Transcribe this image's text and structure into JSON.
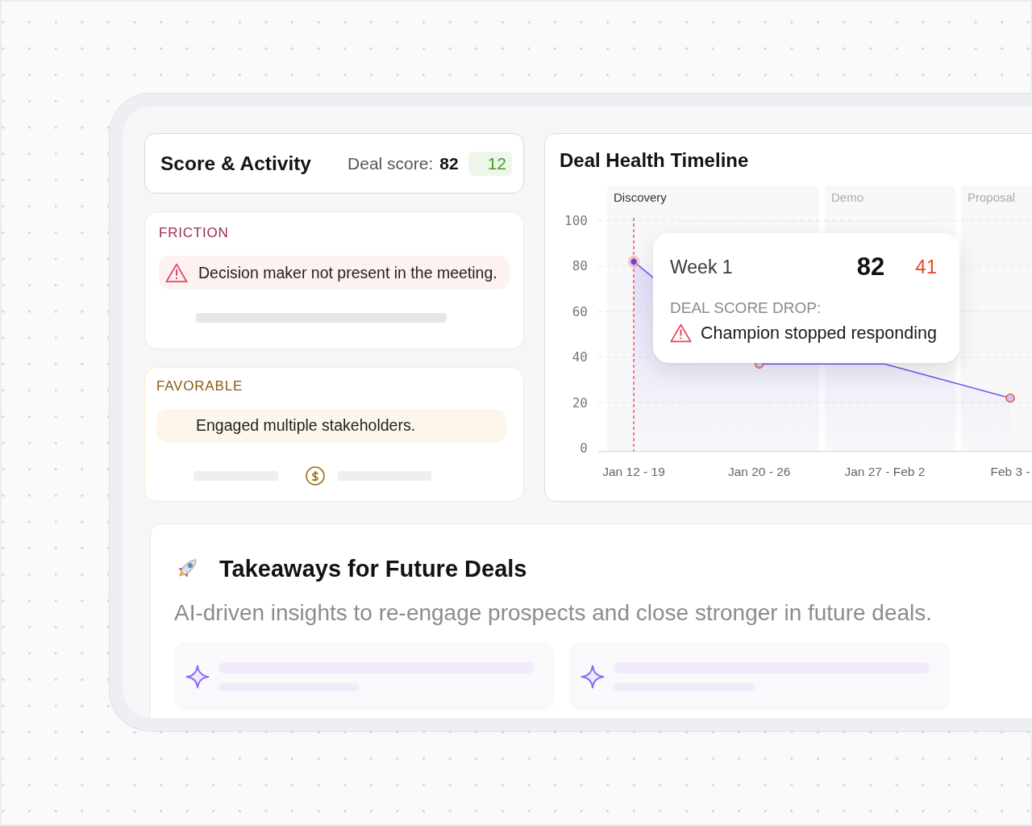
{
  "score_card": {
    "title": "Score & Activity",
    "label": "Deal score:",
    "score": "82",
    "change": "12",
    "positive": true
  },
  "sections": [
    {
      "kind": "friction",
      "title": "FRICTION",
      "items": [
        {
          "text": "Decision maker not present in the meeting."
        }
      ]
    },
    {
      "kind": "favorable",
      "title": "FAVORABLE",
      "items": [
        {
          "text": "Engaged multiple stakeholders."
        }
      ]
    }
  ],
  "timeline": {
    "title": "Deal Health Timeline",
    "phases": [
      {
        "label": "Discovery",
        "selected": true
      },
      {
        "label": "Demo",
        "selected": false
      },
      {
        "label": "Proposal",
        "selected": false
      }
    ],
    "chart_data": {
      "type": "area",
      "categories": [
        "Jan 12 - 19",
        "Jan 20 - 26",
        "Jan 27 - Feb 2",
        "Feb 3 -"
      ],
      "values": [
        82,
        37,
        37,
        22
      ],
      "ylim": [
        0,
        100
      ],
      "yticks": [
        0,
        20,
        40,
        60,
        80,
        100
      ],
      "grid": true,
      "ref_lines": [
        {
          "axis": "x",
          "value": "Jan 12 - 19"
        }
      ]
    },
    "tooltip": {
      "title": "Week 1",
      "score": "82",
      "change": "41",
      "positive": false,
      "label": "DEAL SCORE DROP:",
      "message": "Champion stopped responding"
    }
  },
  "takeaways": {
    "title": "Takeaways for Future Deals",
    "subtitle": "AI-driven insights to re-engage prospects and close stronger in future deals.",
    "cards": [
      {
        "kind": "placeholder"
      },
      {
        "kind": "placeholder"
      }
    ]
  }
}
